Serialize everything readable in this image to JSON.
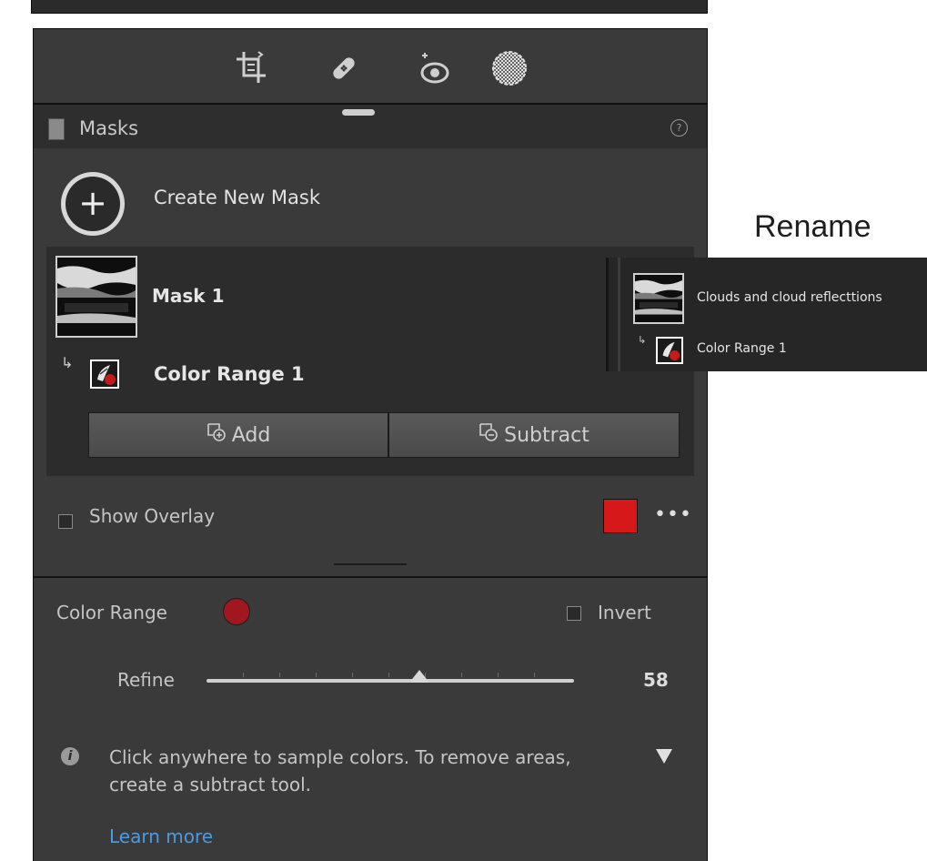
{
  "masks_panel": {
    "title": "Masks",
    "help": "?",
    "create_label": "Create New Mask",
    "create_symbol": "+",
    "mask_name": "Mask 1",
    "component_arrow": "↳",
    "component_name": "Color Range 1",
    "add_label": "Add",
    "subtract_label": "Subtract",
    "show_overlay_label": "Show Overlay",
    "overlay_color": "#d61818",
    "more_symbol": "•••"
  },
  "toolbar": {
    "tools": [
      "crop-icon",
      "healing-icon",
      "red-eye-icon",
      "masking-icon"
    ]
  },
  "color_range": {
    "label": "Color Range",
    "sample_color": "#a0171d",
    "invert_label": "Invert",
    "refine_label": "Refine",
    "refine_value": "58",
    "refine_fraction": 0.58,
    "info_symbol": "i",
    "hint": "Click anywhere to sample colors. To remove areas, create a subtract tool.",
    "learn_more": "Learn more"
  },
  "annotation": {
    "rename_label": "Rename"
  },
  "popout": {
    "mask_name": "Clouds and cloud reflecttions",
    "component_arrow": "↳",
    "component_name": "Color Range 1"
  }
}
